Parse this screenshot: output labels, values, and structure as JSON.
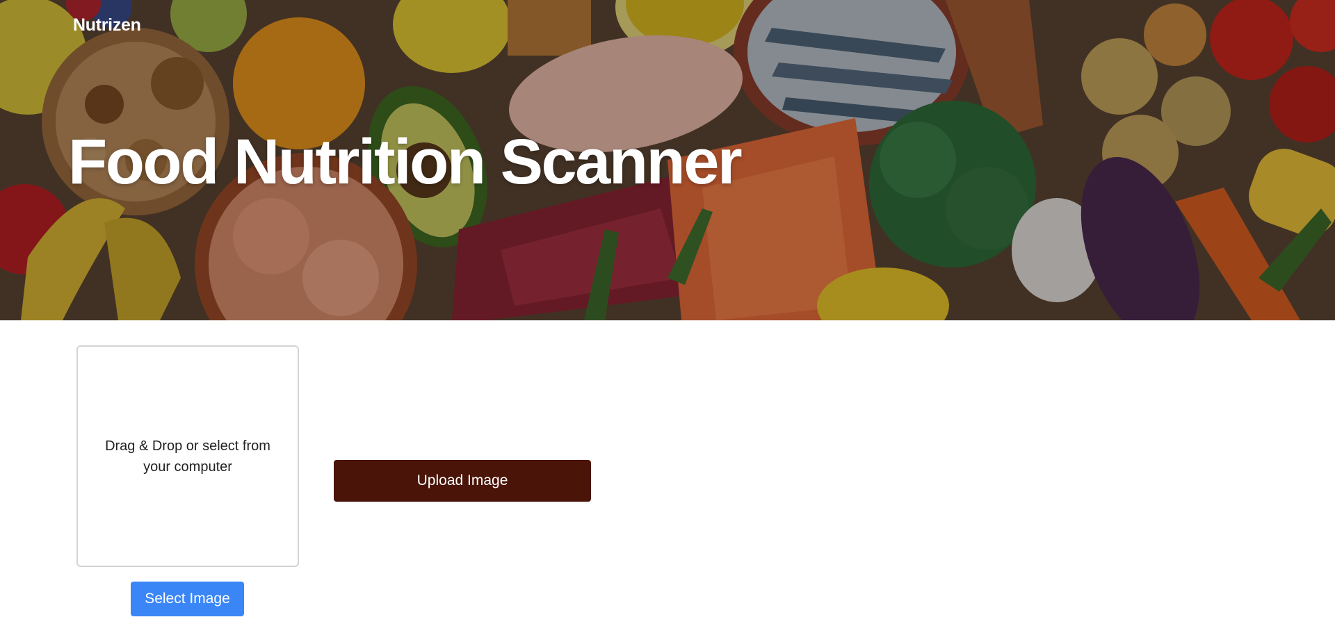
{
  "header": {
    "brand": "Nutrizen"
  },
  "hero": {
    "title": "Food Nutrition Scanner",
    "background_image": "food-assortment-photo"
  },
  "uploader": {
    "dropzone_text": "Drag & Drop or select from your computer",
    "select_label": "Select Image",
    "upload_label": "Upload Image"
  },
  "colors": {
    "select_button": "#3b86f6",
    "upload_button": "#4a1408",
    "title_text": "#ffffff"
  }
}
